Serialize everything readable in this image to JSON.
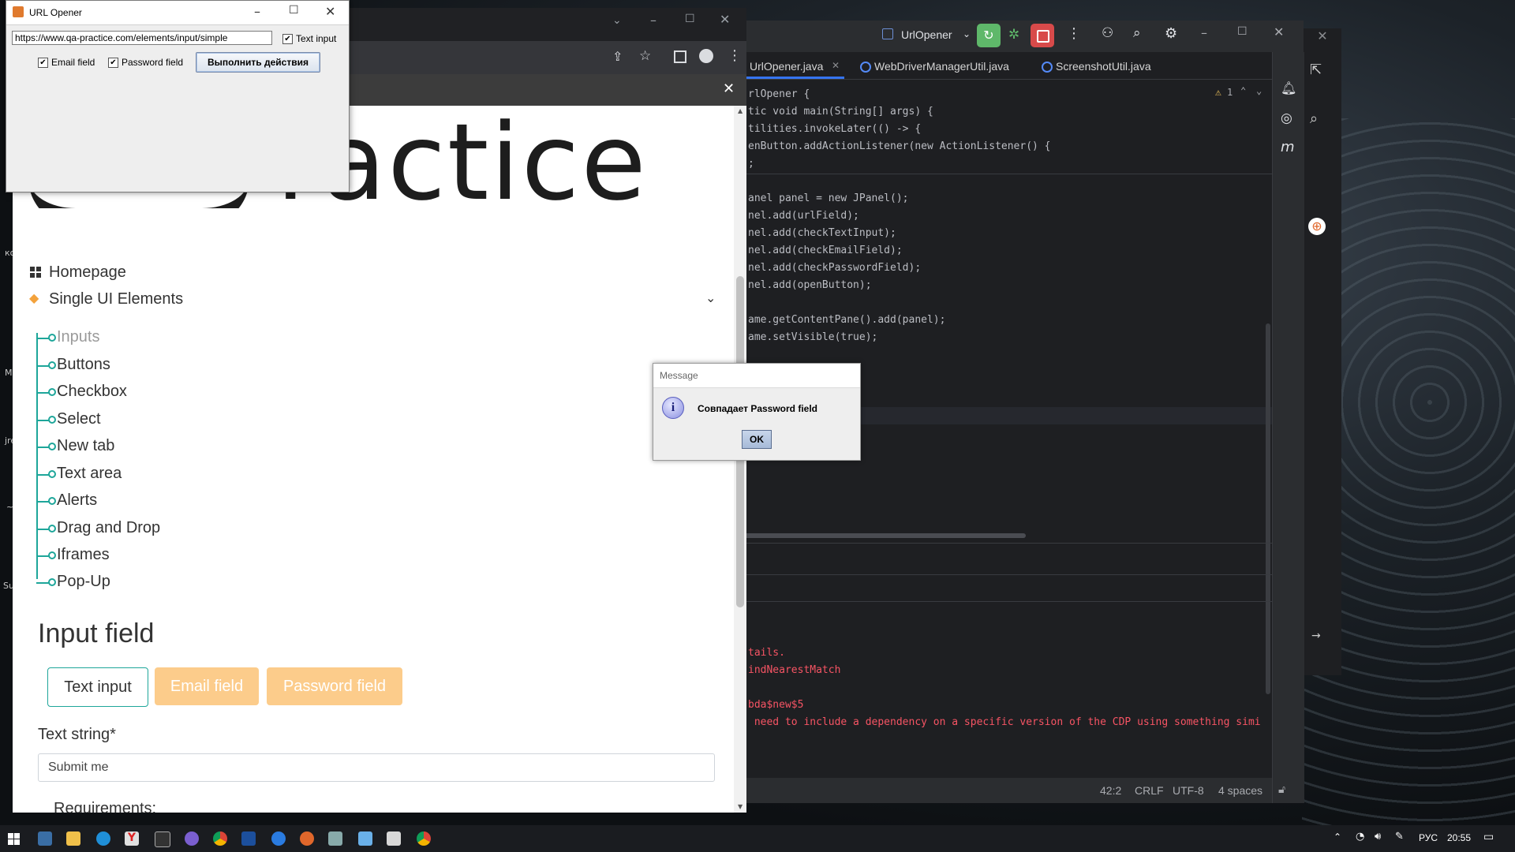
{
  "desktop": {
    "side_labels": [
      "ко",
      "М",
      "jre",
      "~",
      "Su"
    ],
    "right_text": "/..."
  },
  "ide": {
    "run_config": "UrlOpener",
    "tabs": [
      {
        "label": "UrlOpener.java",
        "active": true
      },
      {
        "label": "WebDriverManagerUtil.java",
        "active": false
      },
      {
        "label": "ScreenshotUtil.java",
        "active": false
      }
    ],
    "warning_count": "1",
    "code_lines": [
      "rlOpener {",
      "tic void main(String[] args) {",
      "tilities.invokeLater(() -> {",
      "enButton.addActionListener(new ActionListener() {",
      ";",
      "",
      "anel panel = new JPanel();",
      "nel.add(urlField);",
      "nel.add(checkTextInput);",
      "nel.add(checkEmailField);",
      "nel.add(checkPasswordField);",
      "nel.add(openButton);",
      "",
      "ame.getContentPane().add(panel);",
      "ame.setVisible(true);"
    ],
    "console_lines": [
      "tails.",
      "indNearestMatch",
      "",
      "bda$new$5",
      " need to include a dependency on a specific version of the CDP using something simi"
    ],
    "status": {
      "position": "42:2",
      "line_sep": "CRLF",
      "encoding": "UTF-8",
      "indent": "4 spaces"
    }
  },
  "browser": {
    "logo_visible_text": "ractice",
    "nav": {
      "homepage": "Homepage",
      "single_ui": "Single UI Elements",
      "sub_items": [
        "Inputs",
        "Buttons",
        "Checkbox",
        "Select",
        "New tab",
        "Text area",
        "Alerts",
        "Drag and Drop",
        "Iframes",
        "Pop-Up"
      ]
    },
    "heading": "Input field",
    "pills": [
      "Text input",
      "Email field",
      "Password field"
    ],
    "field_label": "Text string*",
    "field_value": "Submit me",
    "next_section": "Requirements:"
  },
  "url_opener": {
    "title": "URL Opener",
    "url": "https://www.qa-practice.com/elements/input/simple",
    "check_text_input": "Text input",
    "check_email": "Email field",
    "check_password": "Password field",
    "button": "Выполнить действия"
  },
  "message": {
    "title": "Message",
    "text": "Совпадает Password field",
    "ok": "OK"
  },
  "taskbar": {
    "lang": "РУС",
    "time": "20:55"
  }
}
